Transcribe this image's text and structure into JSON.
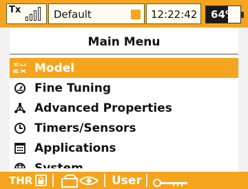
{
  "status": {
    "tx_label": "Tx",
    "tx_sub": "",
    "signal_bars": 4,
    "model_name": "Default",
    "time": "12:22:42",
    "battery_percent": "64%",
    "battery_level": 0.64
  },
  "page": {
    "title": "Main Menu"
  },
  "menu": {
    "items": [
      {
        "label": "Model",
        "icon": "model-icon",
        "selected": true
      },
      {
        "label": "Fine Tuning",
        "icon": "gauge-icon",
        "selected": false
      },
      {
        "label": "Advanced Properties",
        "icon": "network-icon",
        "selected": false
      },
      {
        "label": "Timers/Sensors",
        "icon": "clock-icon",
        "selected": false
      },
      {
        "label": "Applications",
        "icon": "grid-icon",
        "selected": false
      },
      {
        "label": "System",
        "icon": "globe-icon",
        "selected": false
      }
    ]
  },
  "bottom": {
    "thr_label": "THR",
    "lock_icon": "lock-icon",
    "eye_icon": "eye-icon",
    "user_label": "User",
    "key_icon": "key-icon"
  },
  "colors": {
    "accent": "#f4a51d",
    "text": "#111111"
  }
}
